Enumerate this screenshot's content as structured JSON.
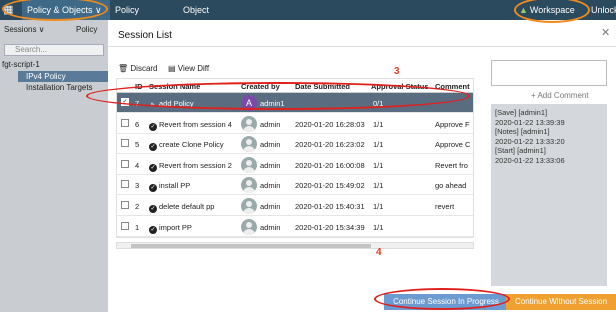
{
  "topbar": {
    "tabs": [
      "Policy & Objects ∨",
      "Policy Packages",
      "Object Configurations"
    ],
    "workspace": "Workspace",
    "unlock": "Unlock"
  },
  "sidebar": {
    "sessions": "Sessions ∨",
    "policy": "Policy",
    "search_placeholder": "Search...",
    "tree": [
      "fgt-script-1",
      "IPv4 Policy",
      "Installation Targets"
    ]
  },
  "modal": {
    "title": "Session List",
    "discard": "Discard",
    "view_diff": "View Diff",
    "columns": [
      "ID",
      "Session Name",
      "Created by",
      "Date Submitted",
      "Approval Status",
      "Comment"
    ],
    "rows": [
      {
        "id": "7",
        "name": "add Policy",
        "created_by": "admin1",
        "date": "",
        "approval": "0/1",
        "comment": "",
        "selected": true,
        "avatar": "A"
      },
      {
        "id": "6",
        "name": "Revert from session 4",
        "created_by": "admin",
        "date": "2020-01-20 16:28:03",
        "approval": "1/1",
        "comment": "Approve F",
        "selected": false,
        "avatar": ""
      },
      {
        "id": "5",
        "name": "create Clone Policy",
        "created_by": "admin",
        "date": "2020-01-20 16:23:02",
        "approval": "1/1",
        "comment": "Approve C",
        "selected": false,
        "avatar": ""
      },
      {
        "id": "4",
        "name": "Revert from session 2",
        "created_by": "admin",
        "date": "2020-01-20 16:00:08",
        "approval": "1/1",
        "comment": "Revert fro",
        "selected": false,
        "avatar": ""
      },
      {
        "id": "3",
        "name": "install PP",
        "created_by": "admin",
        "date": "2020-01-20 15:49:02",
        "approval": "1/1",
        "comment": "go ahead",
        "selected": false,
        "avatar": ""
      },
      {
        "id": "2",
        "name": "delete default pp",
        "created_by": "admin",
        "date": "2020-01-20 15:40:31",
        "approval": "1/1",
        "comment": "revert",
        "selected": false,
        "avatar": ""
      },
      {
        "id": "1",
        "name": "import PP",
        "created_by": "admin",
        "date": "2020-01-20 15:34:39",
        "approval": "1/1",
        "comment": "",
        "selected": false,
        "avatar": ""
      }
    ],
    "add_comment": "Add Comment",
    "notes": [
      "[Save] [admin1]",
      "2020-01-22 13:39:39",
      "[Notes] [admin1]",
      "2020-01-22 13:33:20",
      "[Start] [admin1]",
      "2020-01-22 13:33:06"
    ],
    "continue_btn": "Continue Session In Progress",
    "without_btn": "Continue Without Session"
  },
  "annotations": {
    "step3": "3",
    "step4": "4"
  },
  "colors": {
    "topbar": "#2b4a5e",
    "selected_row": "#5a6d80",
    "continue": "#6c9bd1",
    "without": "#f0a030",
    "annotation": "#e03a1c"
  }
}
